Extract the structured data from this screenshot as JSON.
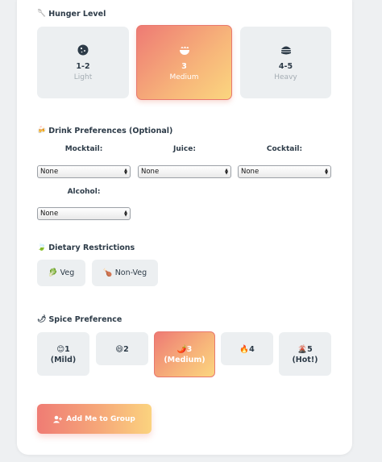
{
  "hunger": {
    "title": "Hunger Level",
    "title_icon": "spoon-icon",
    "options": [
      {
        "icon": "cookie-icon",
        "value": "1-2",
        "label": "Light"
      },
      {
        "icon": "bowl-icon",
        "value": "3",
        "label": "Medium",
        "selected": true
      },
      {
        "icon": "burger-icon",
        "value": "4-5",
        "label": "Heavy"
      }
    ]
  },
  "drinks": {
    "title": "Drink Preferences (Optional)",
    "title_icon": "binoculars-icon",
    "mocktail": {
      "label": "Mocktail:",
      "value": "None"
    },
    "juice": {
      "label": "Juice:",
      "value": "None"
    },
    "cocktail": {
      "label": "Cocktail:",
      "value": "None"
    },
    "alcohol": {
      "label": "Alcohol:",
      "value": "None"
    }
  },
  "dietary": {
    "title": "Dietary Restrictions",
    "title_icon": "leaf-icon",
    "options": [
      {
        "emoji": "🥬",
        "label": "Veg"
      },
      {
        "emoji": "🍗",
        "label": "Non-Veg"
      }
    ]
  },
  "spice": {
    "title": "Spice Preference",
    "title_icon": "pepper-icon",
    "options": [
      {
        "emoji": "😊",
        "num": "1",
        "label": "(Mild)"
      },
      {
        "emoji": "😄",
        "num": "2",
        "label": ""
      },
      {
        "emoji": "🌶️",
        "num": "3",
        "label": "(Medium)",
        "selected": true
      },
      {
        "emoji": "🔥",
        "num": "4",
        "label": ""
      },
      {
        "emoji": "🌋",
        "num": "5",
        "label": "(Hot!)"
      }
    ]
  },
  "add_button": {
    "label": "Add Me to Group",
    "icon": "add-user-icon"
  },
  "colors": {
    "accent_start": "#ef7c74",
    "accent_end": "#fbd37f",
    "option_bg": "#eceff1",
    "text": "#2d3b48"
  }
}
